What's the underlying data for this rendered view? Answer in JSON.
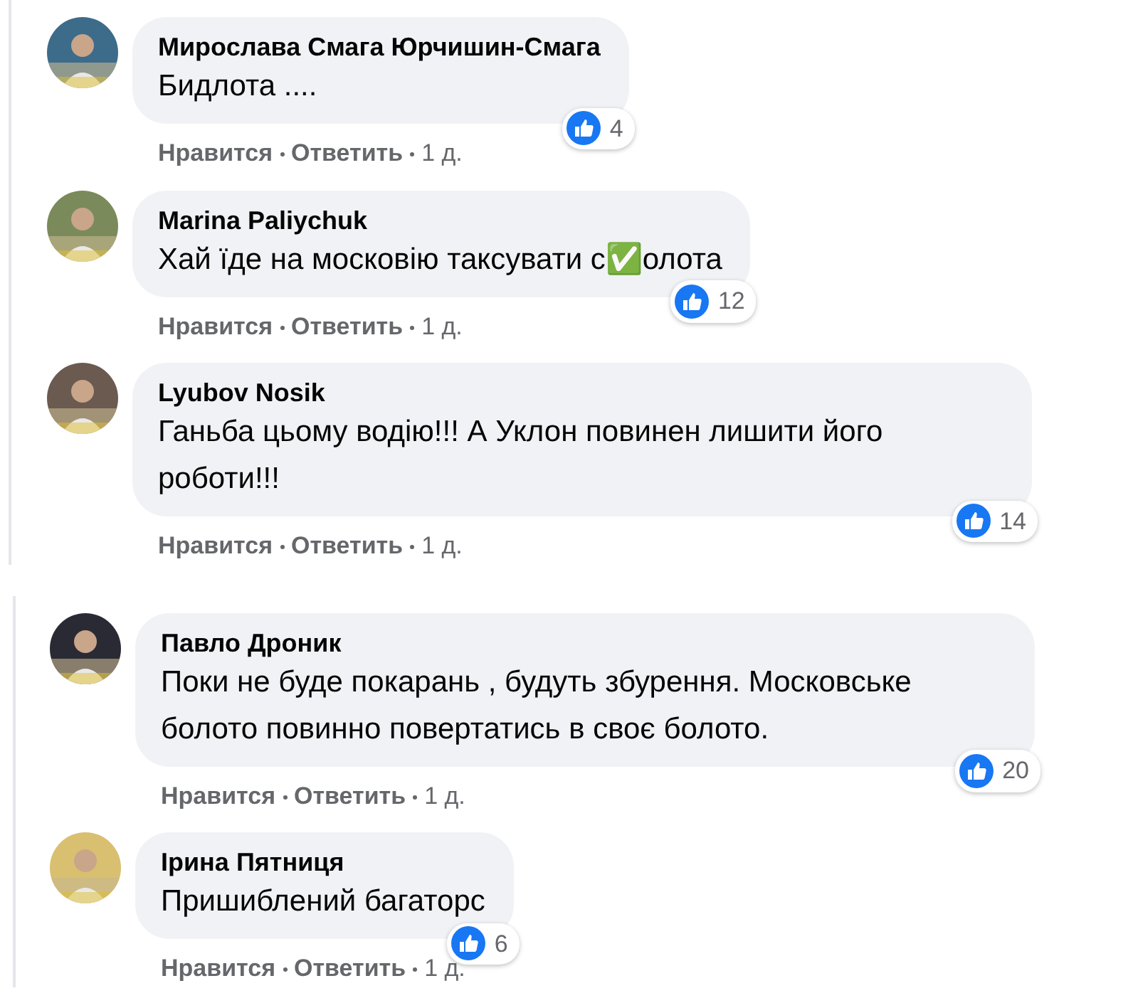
{
  "panels": [
    {
      "comments": [
        {
          "author": "Мирослава Смага Юрчишин-Смага",
          "text": "Бидлота ....",
          "reactions": "4",
          "like": "Нравится",
          "reply": "Ответить",
          "time": "1 д."
        },
        {
          "author": "Marina Paliychuk",
          "text": "Хай їде на московію таксувати с✅олота",
          "reactions": "12",
          "like": "Нравится",
          "reply": "Ответить",
          "time": "1 д."
        },
        {
          "author": "Lyubov Nosik",
          "text": "Ганьба цьому водію!!! А Уклон повинен лишити його роботи!!!",
          "reactions": "14",
          "like": "Нравится",
          "reply": "Ответить",
          "time": "1 д."
        }
      ]
    },
    {
      "comments": [
        {
          "author": "Павло Дроник",
          "text": "Поки не буде покарань , будуть збурення. Московське болото повинно повертатись в своє болото.",
          "reactions": "20",
          "like": "Нравится",
          "reply": "Ответить",
          "time": "1 д."
        },
        {
          "author": "Ірина Пятниця",
          "text": "Пришиблений багаторс",
          "reactions": "6",
          "like": "Нравится",
          "reply": "Ответить",
          "time": "1 д."
        }
      ]
    }
  ]
}
